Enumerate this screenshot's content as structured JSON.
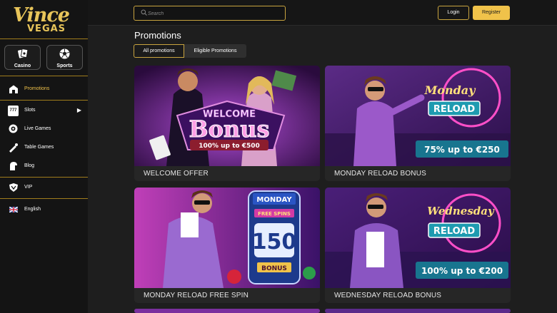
{
  "brand": {
    "logo_line1": "Vince",
    "logo_line2": "VEGAS"
  },
  "modes": [
    {
      "label": "Casino",
      "icon": "playing-cards-icon"
    },
    {
      "label": "Sports",
      "icon": "soccer-ball-icon"
    }
  ],
  "nav": {
    "promotions": "Promotions",
    "slots": "Slots",
    "slots_icon_text": "777",
    "live_games": "Live Games",
    "table_games": "Table Games",
    "blog": "Blog",
    "vip": "VIP",
    "language": "English"
  },
  "search": {
    "placeholder": "Search"
  },
  "auth": {
    "login": "Login",
    "register": "Register"
  },
  "page": {
    "title": "Promotions"
  },
  "tabs": {
    "all": "All promotions",
    "eligible": "Eligible Promotions"
  },
  "cards": [
    {
      "caption": "WELCOME OFFER",
      "line1": "WELCOME",
      "line2": "Bonus",
      "offer": "100% up to €500"
    },
    {
      "caption": "MONDAY RELOAD BONUS",
      "line1": "Monday",
      "line2": "RELOAD",
      "offer": "75% up to €250"
    },
    {
      "caption": "MONDAY RELOAD FREE SPIN",
      "line1": "MONDAY",
      "line2": "FREE SPINS",
      "number": "150",
      "sub": "BONUS"
    },
    {
      "caption": "WEDNESDAY RELOAD BONUS",
      "line1": "Wednesday",
      "line2": "RELOAD",
      "offer": "100% up to €200"
    }
  ],
  "colors": {
    "accent": "#f0c24a",
    "gold_border": "#c9a43f",
    "bg": "#1e1e1e",
    "sidebar_bg": "#141414",
    "card_bg": "#262626"
  }
}
